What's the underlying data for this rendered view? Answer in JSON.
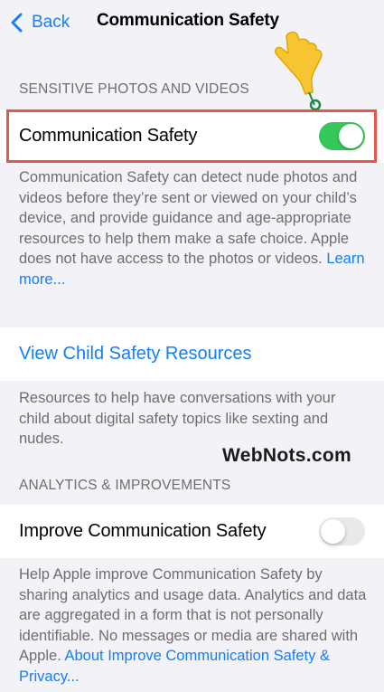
{
  "nav": {
    "back_label": "Back",
    "title": "Communication Safety"
  },
  "sections": {
    "sensitive": {
      "header": "SENSITIVE PHOTOS AND VIDEOS",
      "toggle_label": "Communication Safety",
      "toggle_state": "on",
      "footer_text": "Communication Safety can detect nude photos and videos before they’re sent or viewed on your child’s device, and provide guidance and age-appropriate resources to help them make a safe choice. Apple does not have access to the photos or videos.",
      "footer_link": "Learn more..."
    },
    "resources": {
      "link_label": "View Child Safety Resources",
      "footer_text": "Resources to help have conversations with your child about digital safety topics like sexting and nudes."
    },
    "analytics": {
      "header": "ANALYTICS & IMPROVEMENTS",
      "toggle_label": "Improve Communication Safety",
      "toggle_state": "off",
      "footer_text": "Help Apple improve Communication Safety by sharing analytics and usage data. Analytics and data are aggregated in a form that is not personally identifiable. No messages or media are shared with Apple.",
      "footer_link": "About Improve Communication Safety & Privacy..."
    }
  },
  "watermark": "WebNots.com",
  "colors": {
    "accent": "#147efb",
    "toggle_on": "#34c759",
    "toggle_off": "#e9e9ea",
    "highlight": "#e8574b",
    "pointer": "#f7c531",
    "background": "#f2f2f7"
  },
  "icons": {
    "back": "chevron-left-icon",
    "pointer": "pointing-hand-icon"
  }
}
